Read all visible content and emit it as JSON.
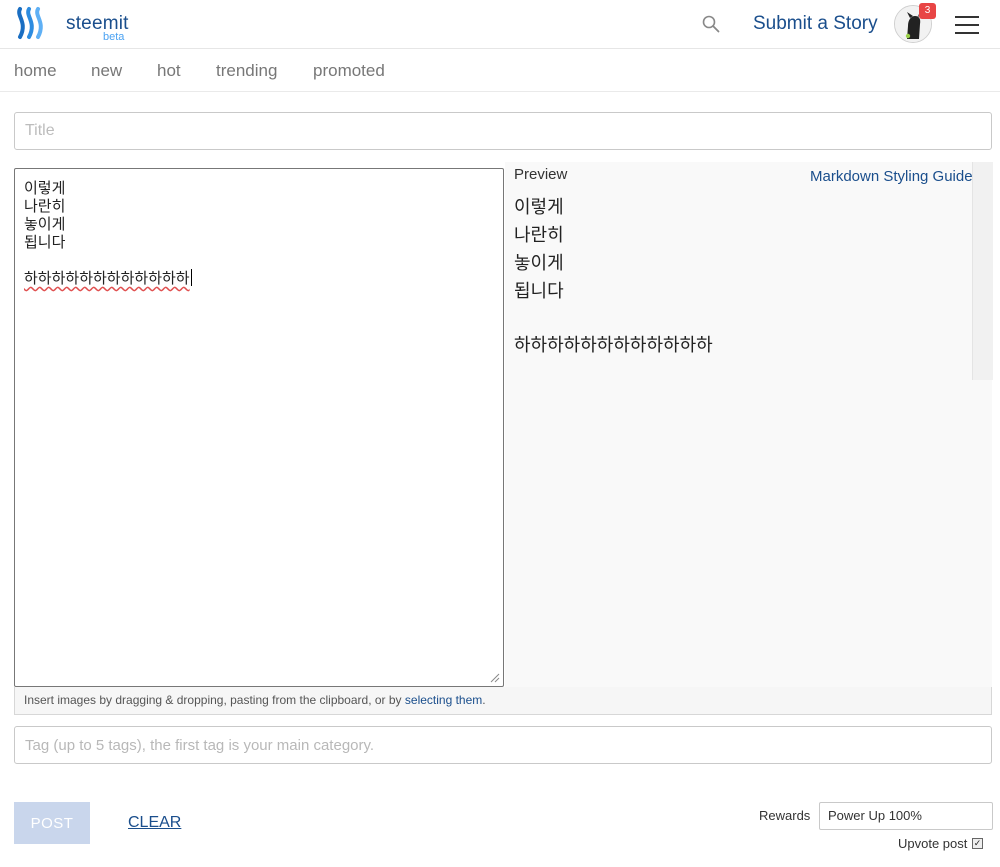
{
  "header": {
    "brand": "steemit",
    "brand_sub": "beta",
    "submit_label": "Submit a Story",
    "notification_count": "3"
  },
  "subnav": {
    "items": [
      {
        "label": "home"
      },
      {
        "label": "new"
      },
      {
        "label": "hot"
      },
      {
        "label": "trending"
      },
      {
        "label": "promoted"
      }
    ]
  },
  "form": {
    "title_placeholder": "Title",
    "body_lines": [
      "이렇게",
      "나란히",
      "놓이게",
      "됩니다",
      "",
      "하하하하하하하하하하하하"
    ],
    "preview_label": "Preview",
    "markdown_guide": "Markdown Styling Guide",
    "upload_hint_prefix": "Insert images by dragging & dropping, pasting from the clipboard, or by ",
    "upload_hint_link": "selecting them",
    "upload_hint_suffix": ".",
    "tags_placeholder": "Tag (up to 5 tags), the first tag is your main category.",
    "post_label": "POST",
    "clear_label": "CLEAR",
    "rewards_label": "Rewards",
    "rewards_value": "Power Up 100%",
    "upvote_label": "Upvote post",
    "upvote_checked": true
  },
  "colors": {
    "link": "#1a4e8c",
    "brand_accent": "#4ba2f2",
    "badge": "#e84545",
    "post_disabled": "#c9d6ec"
  }
}
